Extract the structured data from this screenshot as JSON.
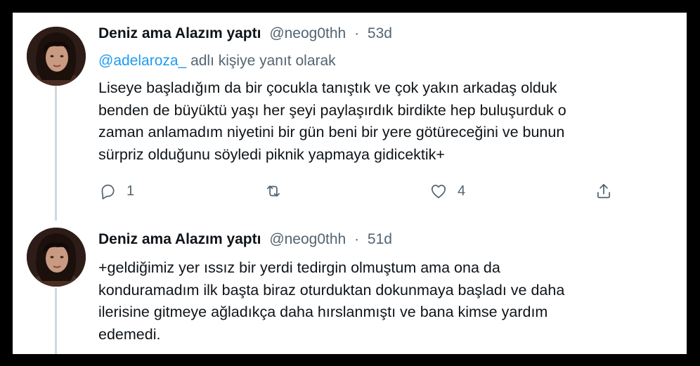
{
  "tweets": [
    {
      "display_name": "Deniz ama Alazım yaptı",
      "handle": "@neog0thh",
      "separator": "·",
      "time": "53d",
      "reply_to_handle": "@adelaroza_",
      "reply_to_suffix": "adlı kişiye yanıt olarak",
      "lines": [
        "Liseye başladığım da bir çocukla tanıştık ve çok yakın arkadaş olduk",
        "benden de büyüktü yaşı her şeyi paylaşırdık birdikte hep buluşurduk o",
        "zaman anlamadım niyetini bir gün beni bir yere götüreceğini ve bunun",
        "sürpriz olduğunu söyledi piknik yapmaya gidicektik+"
      ],
      "reply_count": "1",
      "retweet_count": "",
      "like_count": "4"
    },
    {
      "display_name": "Deniz ama Alazım yaptı",
      "handle": "@neog0thh",
      "separator": "·",
      "time": "51d",
      "lines": [
        "+geldiğimiz yer ıssız bir yerdi tedirgin olmuştum ama ona da",
        "konduramadım ilk başta biraz oturduktan dokunmaya başladı ve daha",
        "ilerisine gitmeye ağladıkça daha hırslanmıştı ve bana kimse yardım",
        "edemedi."
      ]
    }
  ],
  "icons": {
    "reply": "reply-icon",
    "retweet": "retweet-icon",
    "like": "heart-icon",
    "share": "share-icon"
  },
  "colors": {
    "link": "#1d9bf0",
    "secondary": "#536471",
    "text": "#0f1419",
    "thread_line": "#cfd9de"
  }
}
